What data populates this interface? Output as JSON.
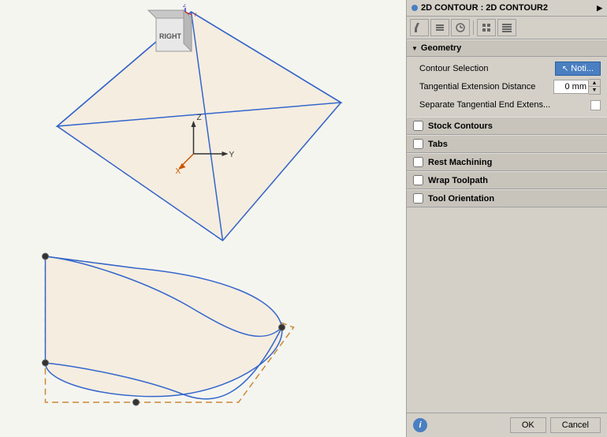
{
  "header": {
    "title": "2D CONTOUR : 2D CONTOUR2",
    "expand_icon": "▶"
  },
  "toolbar": {
    "buttons": [
      {
        "name": "tool-btn-1",
        "icon": "✎"
      },
      {
        "name": "tool-btn-2",
        "icon": "⧉"
      },
      {
        "name": "tool-btn-3",
        "icon": "◷"
      },
      {
        "name": "tool-btn-4",
        "icon": "▦"
      },
      {
        "name": "tool-btn-5",
        "icon": "⊞"
      }
    ]
  },
  "geometry_section": {
    "title": "Geometry",
    "triangle": "▼",
    "contour_selection": {
      "label": "Contour Selection",
      "button_text": "Noti...",
      "cursor_icon": "↖"
    },
    "tangential_extension": {
      "label": "Tangential Extension Distance",
      "value": "0 mm"
    },
    "separate_tangential": {
      "label": "Separate Tangential End Extens...",
      "checked": false
    }
  },
  "stock_contours": {
    "label": "Stock Contours",
    "checked": false
  },
  "tabs": {
    "label": "Tabs",
    "checked": false
  },
  "rest_machining": {
    "label": "Rest Machining",
    "checked": false
  },
  "wrap_toolpath": {
    "label": "Wrap Toolpath",
    "checked": false
  },
  "tool_orientation": {
    "label": "Tool Orientation",
    "checked": false
  },
  "bottom_bar": {
    "info_icon": "i",
    "ok_label": "OK",
    "cancel_label": "Cancel"
  },
  "view": {
    "label": "RIGHT",
    "axes": {
      "x": "X",
      "y": "Y",
      "z": "Z"
    }
  }
}
